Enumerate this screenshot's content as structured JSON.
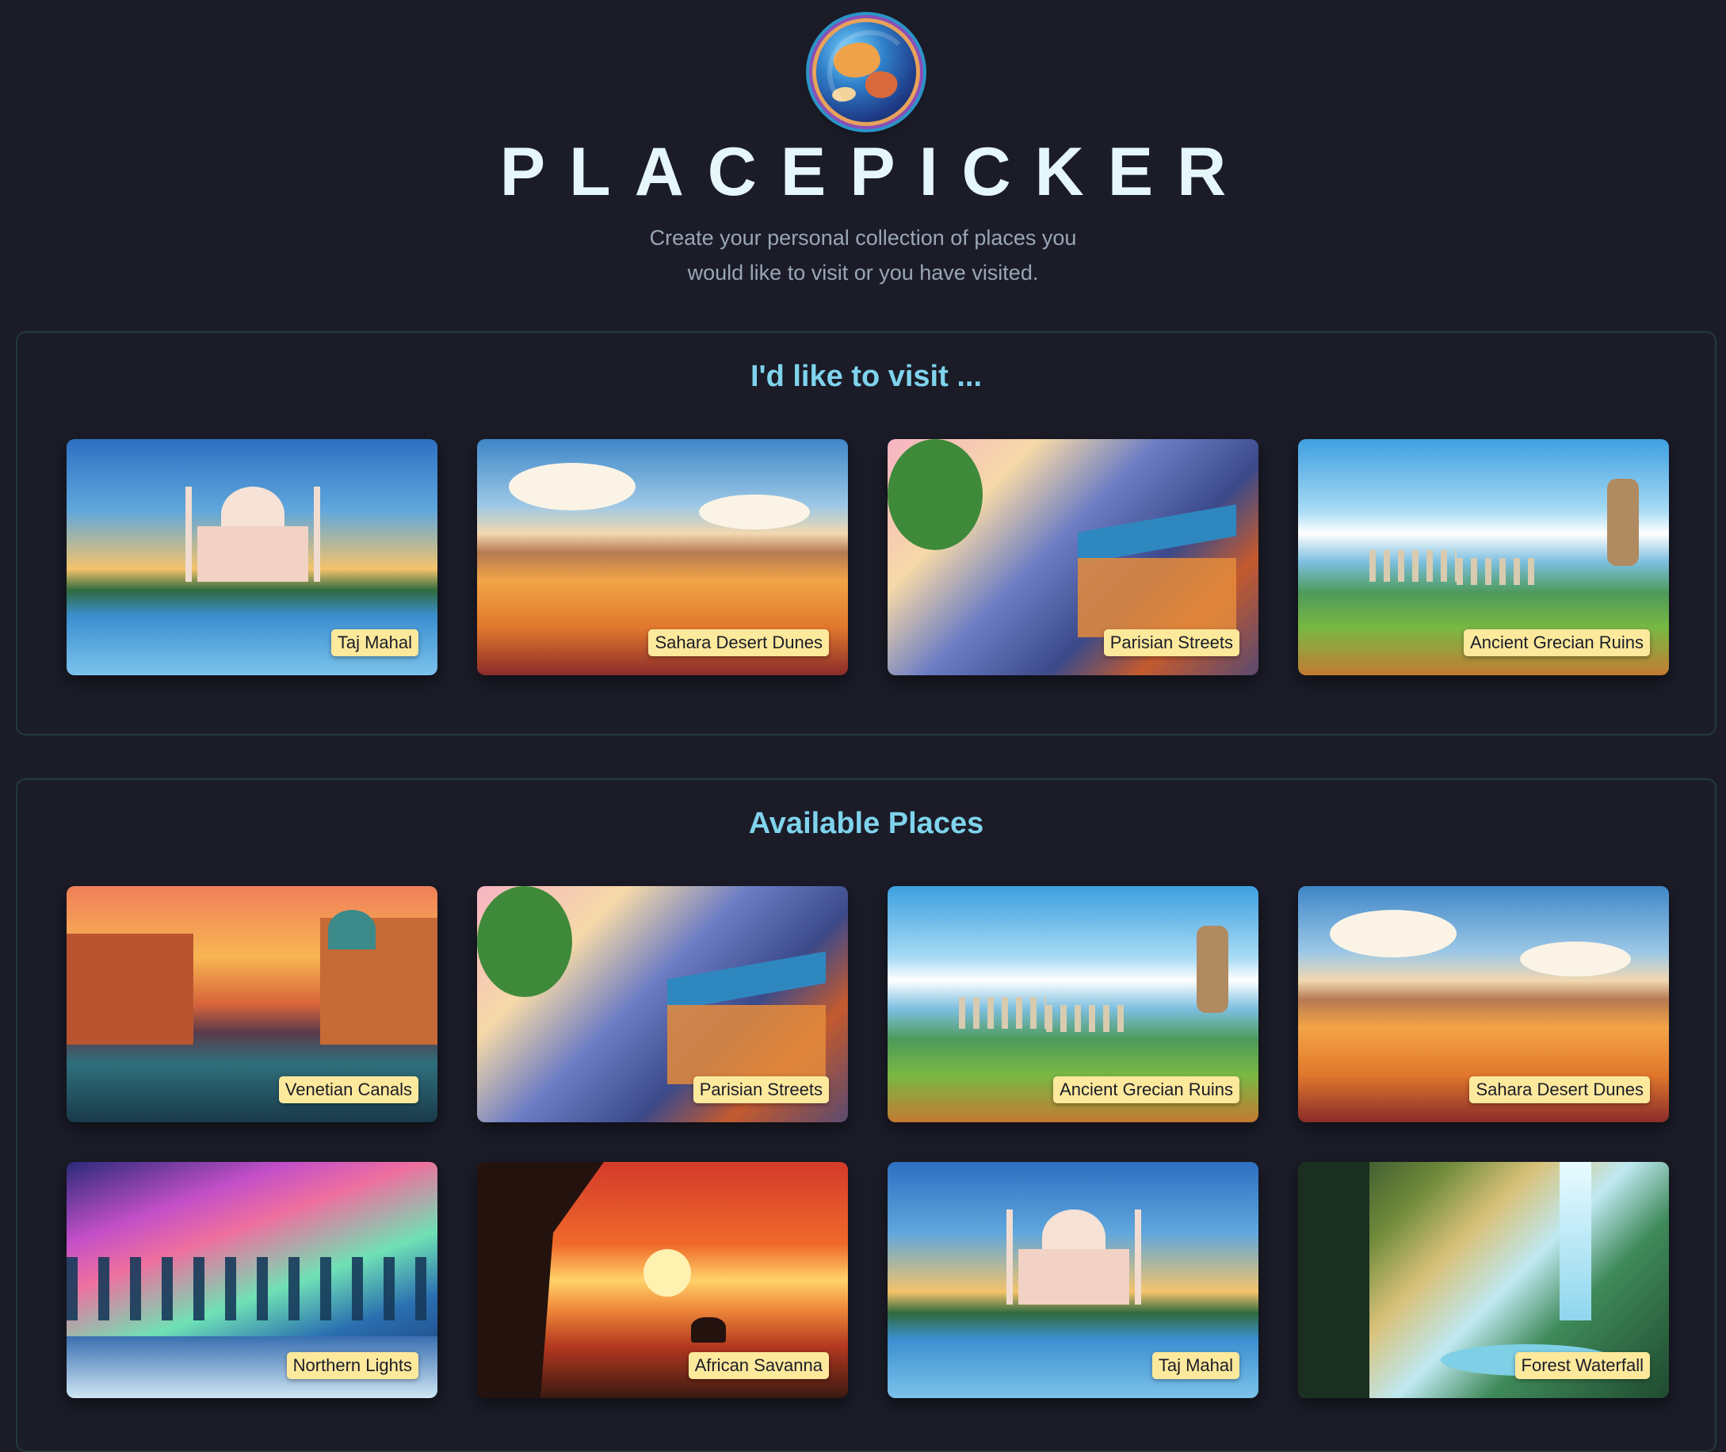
{
  "header": {
    "title": "PLACEPICKER",
    "subtitle": "Create your personal collection of places you would like to visit or you have visited."
  },
  "sections": [
    {
      "title": "I'd like to visit ...",
      "places": [
        {
          "label": "Taj Mahal"
        },
        {
          "label": "Sahara Desert Dunes"
        },
        {
          "label": "Parisian Streets"
        },
        {
          "label": "Ancient Grecian Ruins"
        }
      ]
    },
    {
      "title": "Available Places",
      "places": [
        {
          "label": "Venetian Canals"
        },
        {
          "label": "Parisian Streets"
        },
        {
          "label": "Ancient Grecian Ruins"
        },
        {
          "label": "Sahara Desert Dunes"
        },
        {
          "label": "Northern Lights"
        },
        {
          "label": "African Savanna"
        },
        {
          "label": "Taj Mahal"
        },
        {
          "label": "Forest Waterfall"
        }
      ]
    }
  ],
  "colors": {
    "background": "#1b1c28",
    "title": "#e6f7fb",
    "section_heading": "#7fd3ec",
    "label_bg": "#fde99c"
  }
}
